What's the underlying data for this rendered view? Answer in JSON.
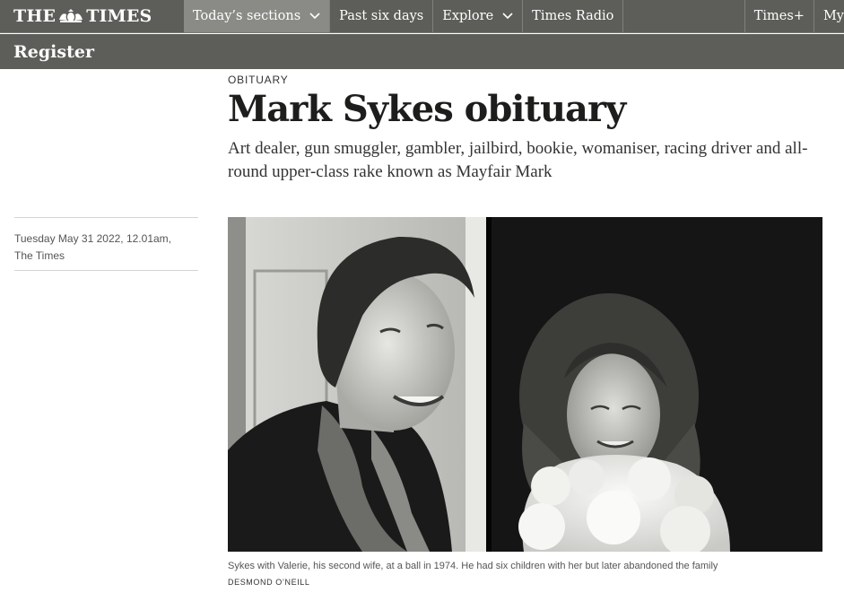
{
  "header": {
    "logo_text_left": "THE",
    "logo_text_right": "TIMES",
    "nav": [
      {
        "label": "Today’s sections",
        "dropdown": true,
        "active": true
      },
      {
        "label": "Past six days",
        "dropdown": false
      },
      {
        "label": "Explore",
        "dropdown": true
      },
      {
        "label": "Times Radio",
        "dropdown": false
      }
    ],
    "right_nav": [
      {
        "label": "Times+"
      },
      {
        "label": "My"
      }
    ],
    "register_label": "Register"
  },
  "article": {
    "section": "OBITUARY",
    "headline": "Mark Sykes obituary",
    "standfirst": "Art dealer, gun smuggler, gambler, jailbird, bookie, womaniser, racing driver and all-round upper-class rake known as Mayfair Mark",
    "byline": {
      "date": "Tuesday May 31 2022, 12.01am,",
      "publication": "The Times"
    },
    "photo": {
      "caption": "Sykes with Valerie, his second wife, at a ball in 1974. He had six children with her but later abandoned the family",
      "credit": "DESMOND O’NEILL"
    }
  },
  "colors": {
    "nav_bg": "#5d5d5a",
    "nav_active": "#8a8a87",
    "text": "#1d1d1b"
  }
}
